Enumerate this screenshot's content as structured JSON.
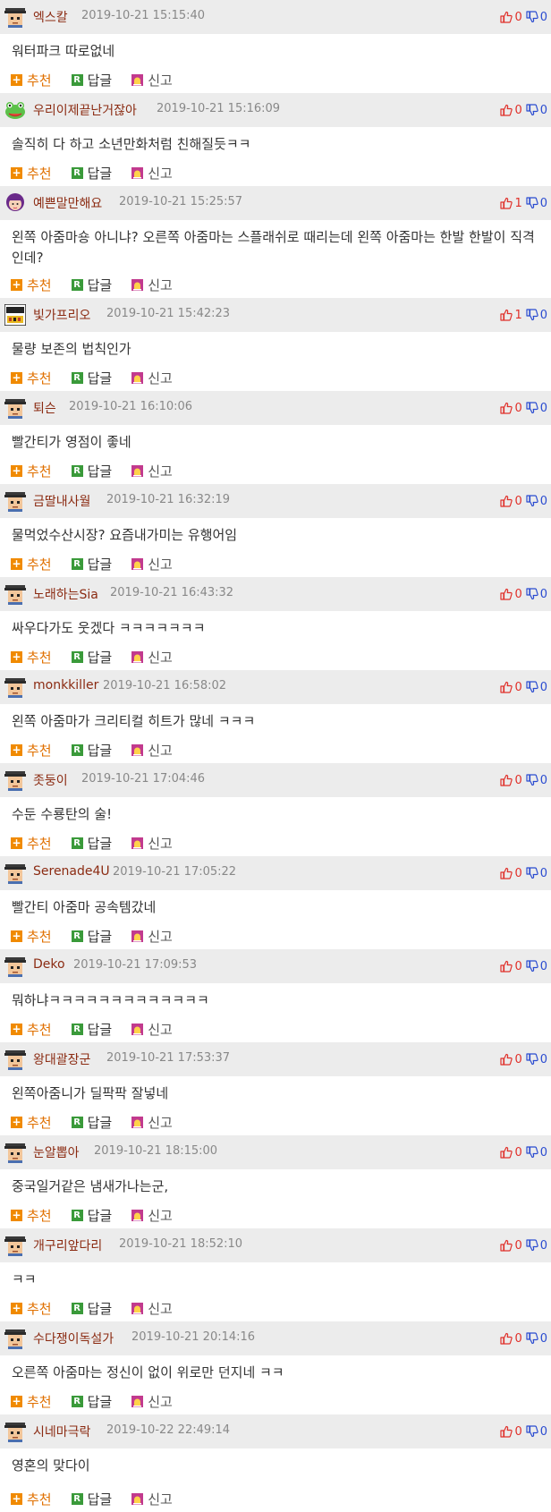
{
  "labels": {
    "recommend": "추천",
    "reply": "답글",
    "report": "신고"
  },
  "colors": {
    "header_bg": "#ececec",
    "author": "#8b2b12",
    "upvote": "#e0302a",
    "downvote": "#2a4bd0",
    "recommend": "#e07000"
  },
  "comments": [
    {
      "author": "엑스칼",
      "date": "2019-10-21 15:15:40",
      "up": "0",
      "down": "0",
      "body": "워터파크 따로없네",
      "avatar": "default-avatar"
    },
    {
      "author": "우리이제끝난거잖아",
      "date": "2019-10-21 15:16:09",
      "up": "0",
      "down": "0",
      "body": "솔직히 다 하고 소년만화처럼 친해질듯ㅋㅋ",
      "avatar": "frog-avatar"
    },
    {
      "author": "예쁜말만해요",
      "date": "2019-10-21 15:25:57",
      "up": "1",
      "down": "0",
      "body": "왼쪽 아줌마숑 아니냐? 오른쪽 아줌마는 스플래쉬로 때리는데 왼쪽 아줌마는 한발 한발이 직격인데?",
      "avatar": "girl-avatar"
    },
    {
      "author": "빛가프리오",
      "date": "2019-10-21 15:42:23",
      "up": "1",
      "down": "0",
      "body": "물량 보존의 법칙인가",
      "avatar": "badge-avatar"
    },
    {
      "author": "퇴슨",
      "date": "2019-10-21 16:10:06",
      "up": "0",
      "down": "0",
      "body": "빨간티가 영점이 좋네",
      "avatar": "default-avatar"
    },
    {
      "author": "금딸내사월",
      "date": "2019-10-21 16:32:19",
      "up": "0",
      "down": "0",
      "body": "물먹었수산시장? 요즘내가미는 유행어임",
      "avatar": "default-avatar"
    },
    {
      "author": "노래하는Sia",
      "date": "2019-10-21 16:43:32",
      "up": "0",
      "down": "0",
      "body": "싸우다가도 웃겠다 ㅋㅋㅋㅋㅋㅋㅋ",
      "avatar": "default-avatar"
    },
    {
      "author": "monkkiller",
      "date": "2019-10-21 16:58:02",
      "up": "0",
      "down": "0",
      "body": "왼쪽 아줌마가 크리티컬 히트가 많네 ㅋㅋㅋ",
      "avatar": "default-avatar"
    },
    {
      "author": "좃둥이",
      "date": "2019-10-21 17:04:46",
      "up": "0",
      "down": "0",
      "body": "수둔 수룡탄의 술!",
      "avatar": "default-avatar"
    },
    {
      "author": "Serenade4U",
      "date": "2019-10-21 17:05:22",
      "up": "0",
      "down": "0",
      "body": "빨간티 아줌마 공속템갔네",
      "avatar": "default-avatar"
    },
    {
      "author": "Deko",
      "date": "2019-10-21 17:09:53",
      "up": "0",
      "down": "0",
      "body": "뭐하냐ㅋㅋㅋㅋㅋㅋㅋㅋㅋㅋㅋㅋㅋ",
      "avatar": "default-avatar"
    },
    {
      "author": "왕대괄장군",
      "date": "2019-10-21 17:53:37",
      "up": "0",
      "down": "0",
      "body": "왼쪽아줌니가 딜팍팍 잘넣네",
      "avatar": "default-avatar"
    },
    {
      "author": "눈알뽑아",
      "date": "2019-10-21 18:15:00",
      "up": "0",
      "down": "0",
      "body": "중국일거같은 냄새가나는군,",
      "avatar": "default-avatar"
    },
    {
      "author": "개구리앞다리",
      "date": "2019-10-21 18:52:10",
      "up": "0",
      "down": "0",
      "body": "ㅋㅋ",
      "avatar": "default-avatar"
    },
    {
      "author": "수다쟁이독설가",
      "date": "2019-10-21 20:14:16",
      "up": "0",
      "down": "0",
      "body": "오른쪽 아줌마는 정신이 없이 위로만 던지네 ㅋㅋ",
      "avatar": "default-avatar"
    },
    {
      "author": "시네마극락",
      "date": "2019-10-22 22:49:14",
      "up": "0",
      "down": "0",
      "body": "영혼의 맞다이",
      "avatar": "default-avatar"
    }
  ]
}
